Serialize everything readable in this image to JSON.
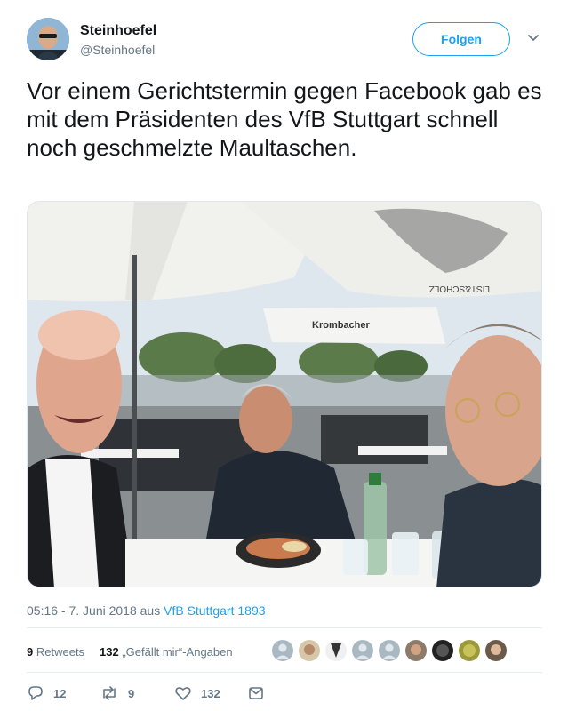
{
  "user": {
    "name": "Steinhoefel",
    "handle": "@Steinhoefel"
  },
  "follow_label": "Folgen",
  "tweet": {
    "text": "Vor einem Gerichtstermin gegen Facebook gab es mit dem Präsidenten des VfB Stuttgart schnell noch geschmelzte Maultaschen."
  },
  "photo": {
    "umbrella_text_1": "LIST&SCHOLZ",
    "umbrella_text_2": "Krombacher"
  },
  "meta": {
    "time": "05:16 - 7. Juni 2018 aus ",
    "source": "VfB Stuttgart 1893"
  },
  "stats": {
    "retweets_count": "9",
    "retweets_label": "Retweets",
    "likes_count": "132",
    "likes_label": "„Gefällt mir“-Angaben"
  },
  "actions": {
    "reply_count": "12",
    "retweet_count": "9",
    "like_count": "132"
  },
  "colors": {
    "accent": "#1da1f2",
    "secondary_text": "#657786",
    "divider": "#e6ecf0"
  },
  "icons": [
    "caret-down-icon",
    "reply-icon",
    "retweet-icon",
    "heart-icon",
    "message-icon"
  ]
}
